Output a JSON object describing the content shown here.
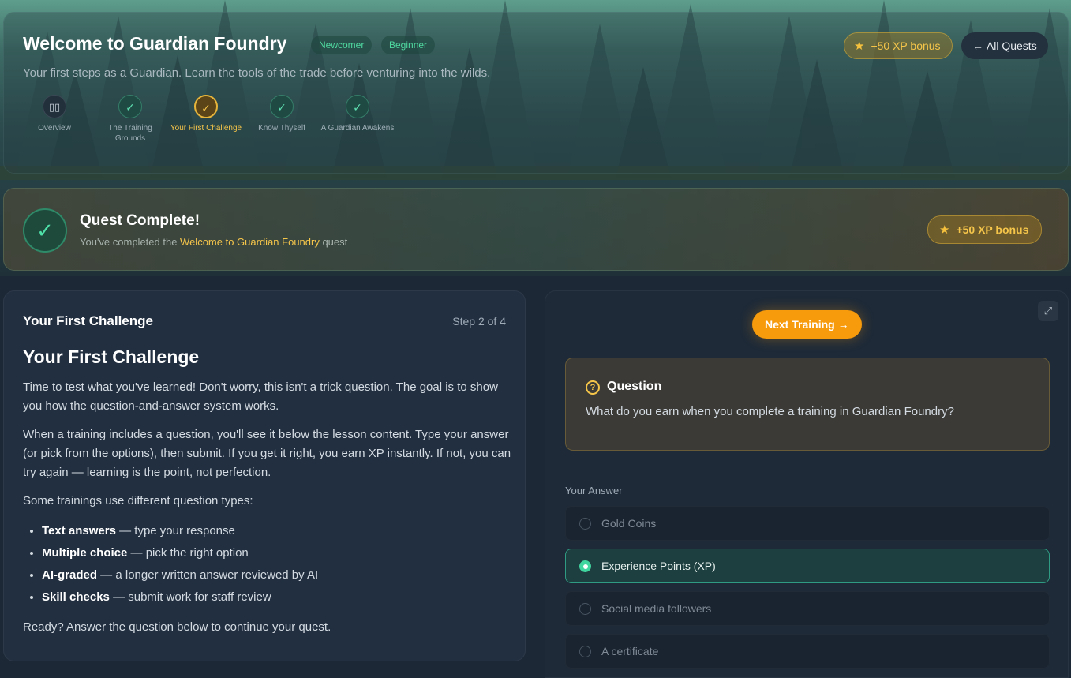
{
  "header": {
    "title": "Welcome to Guardian Foundry",
    "tags": [
      "Newcomer",
      "Beginner"
    ],
    "subtitle": "Your first steps as a Guardian. Learn the tools of the trade before venturing into the wilds.",
    "xp_bonus": "+50 XP bonus",
    "all_quests": "All Quests"
  },
  "steps": [
    {
      "label": "Overview",
      "icon": "book-icon"
    },
    {
      "label": "The Training Grounds",
      "icon": "check-icon"
    },
    {
      "label": "Your First Challenge",
      "icon": "check-icon",
      "active": true
    },
    {
      "label": "Know Thyself",
      "icon": "check-icon"
    },
    {
      "label": "A Guardian Awakens",
      "icon": "check-icon"
    }
  ],
  "banner": {
    "title": "Quest Complete!",
    "sub_prefix": "You've completed the ",
    "sub_highlight": "Welcome to Guardian Foundry",
    "sub_suffix": " quest",
    "xp_bonus": "+50 XP bonus"
  },
  "lesson": {
    "card_title": "Your First Challenge",
    "step": "Step 2 of 4",
    "heading": "Your First Challenge",
    "p1": "Time to test what you've learned! Don't worry, this isn't a trick question. The goal is to show you how the question-and-answer system works.",
    "p2": "When a training includes a question, you'll see it below the lesson content. Type your answer (or pick from the options), then submit. If you get it right, you earn XP instantly. If not, you can try again — learning is the point, not perfection.",
    "p3": "Some trainings use different question types:",
    "bullets": [
      {
        "bold": "Text answers",
        "rest": " — type your response"
      },
      {
        "bold": "Multiple choice",
        "rest": " — pick the right option"
      },
      {
        "bold": "AI-graded",
        "rest": " — a longer written answer reviewed by AI"
      },
      {
        "bold": "Skill checks",
        "rest": " — submit work for staff review"
      }
    ],
    "p4": "Ready? Answer the question below to continue your quest."
  },
  "panel": {
    "next_button": "Next Training →",
    "question_label": "Question",
    "question_text": "What do you earn when you complete a training in Guardian Foundry?",
    "answer_label": "Your Answer",
    "options": [
      {
        "label": "Gold Coins",
        "selected": false
      },
      {
        "label": "Experience Points (XP)",
        "selected": true
      },
      {
        "label": "Social media followers",
        "selected": false
      },
      {
        "label": "A certificate",
        "selected": false
      }
    ]
  },
  "colors": {
    "accent": "#f79a0c",
    "success": "#40d6a0",
    "gold": "#f5c54a"
  }
}
